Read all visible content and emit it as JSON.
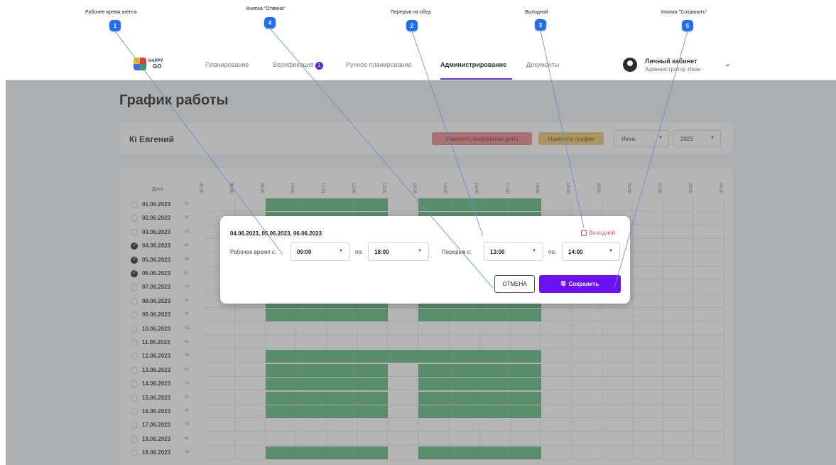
{
  "callouts": [
    {
      "num": "1",
      "label": "Рабочее время агента"
    },
    {
      "num": "4",
      "label": "Кнопка \"Отмена\""
    },
    {
      "num": "2",
      "label": "Перерыв на обед"
    },
    {
      "num": "3",
      "label": "Выходной"
    },
    {
      "num": "5",
      "label": "Кнопка \"Сохранить\""
    }
  ],
  "header": {
    "logo_line1": "HAPPY",
    "logo_line2": "GO",
    "nav": [
      {
        "label": "Планирование"
      },
      {
        "label": "Верификация",
        "badge": "1"
      },
      {
        "label": "Ручное планирование"
      },
      {
        "label": "Администрирование"
      },
      {
        "label": "Документы"
      }
    ],
    "active_nav": "Администрирование",
    "user_title": "Личный кабинет",
    "user_role": "Администратор Иван"
  },
  "page": {
    "title": "График работы",
    "employee": "Кі Евгений",
    "btn_change_dates": "Изменить выбранные даты",
    "btn_change_schedule": "Изменить график",
    "month": "Июнь",
    "year": "2023"
  },
  "grid": {
    "date_header": "Дата",
    "hours": [
      "07:00",
      "08:00",
      "09:00",
      "10:00",
      "11:00",
      "12:00",
      "13:00",
      "14:00",
      "15:00",
      "16:00",
      "17:00",
      "18:00",
      "19:00",
      "20:00",
      "21:00",
      "22:00",
      "23:00",
      "24:00"
    ],
    "rows": [
      {
        "date": "01.06.2023",
        "dow": "чт",
        "weekend": false,
        "checked": false
      },
      {
        "date": "02.06.2023",
        "dow": "пт",
        "weekend": false,
        "checked": false
      },
      {
        "date": "03.06.2023",
        "dow": "сб",
        "weekend": true,
        "checked": false
      },
      {
        "date": "04.06.2023",
        "dow": "вс",
        "weekend": true,
        "checked": true
      },
      {
        "date": "05.06.2023",
        "dow": "пн",
        "weekend": false,
        "checked": true
      },
      {
        "date": "06.06.2023",
        "dow": "вт",
        "weekend": false,
        "checked": true
      },
      {
        "date": "07.06.2023",
        "dow": "ср",
        "weekend": false,
        "checked": false
      },
      {
        "date": "08.06.2023",
        "dow": "чт",
        "weekend": false,
        "checked": false
      },
      {
        "date": "09.06.2023",
        "dow": "пт",
        "weekend": false,
        "checked": false
      },
      {
        "date": "10.06.2023",
        "dow": "сб",
        "weekend": true,
        "checked": false
      },
      {
        "date": "11.06.2023",
        "dow": "вс",
        "weekend": true,
        "checked": false
      },
      {
        "date": "12.06.2023",
        "dow": "пн",
        "weekend": false,
        "checked": false
      },
      {
        "date": "13.06.2023",
        "dow": "вт",
        "weekend": false,
        "checked": false
      },
      {
        "date": "14.06.2023",
        "dow": "ср",
        "weekend": false,
        "checked": false
      },
      {
        "date": "15.06.2023",
        "dow": "чт",
        "weekend": false,
        "checked": false
      },
      {
        "date": "16.06.2023",
        "dow": "пт",
        "weekend": false,
        "checked": false
      },
      {
        "date": "17.06.2023",
        "dow": "сб",
        "weekend": true,
        "checked": false
      },
      {
        "date": "18.06.2023",
        "dow": "вс",
        "weekend": true,
        "checked": false
      },
      {
        "date": "19.06.2023",
        "dow": "пн",
        "weekend": false,
        "checked": false
      }
    ]
  },
  "modal": {
    "dates": "04.06.2023, 05.06.2023, 06.06.2023",
    "work_label": "Рабочее время с:",
    "work_from": "09:00",
    "to_label": "по:",
    "work_to": "18:00",
    "break_label": "Перерыв с:",
    "break_from": "13:00",
    "break_to_label": "по:",
    "break_to": "14:00",
    "dayoff_label": "Выходной",
    "cancel": "ОТМЕНА",
    "save": "Сохранить"
  },
  "colors": {
    "accent": "#6b10f0",
    "shift": "#5cb87a",
    "callout_badge": "#1e6ff2"
  }
}
